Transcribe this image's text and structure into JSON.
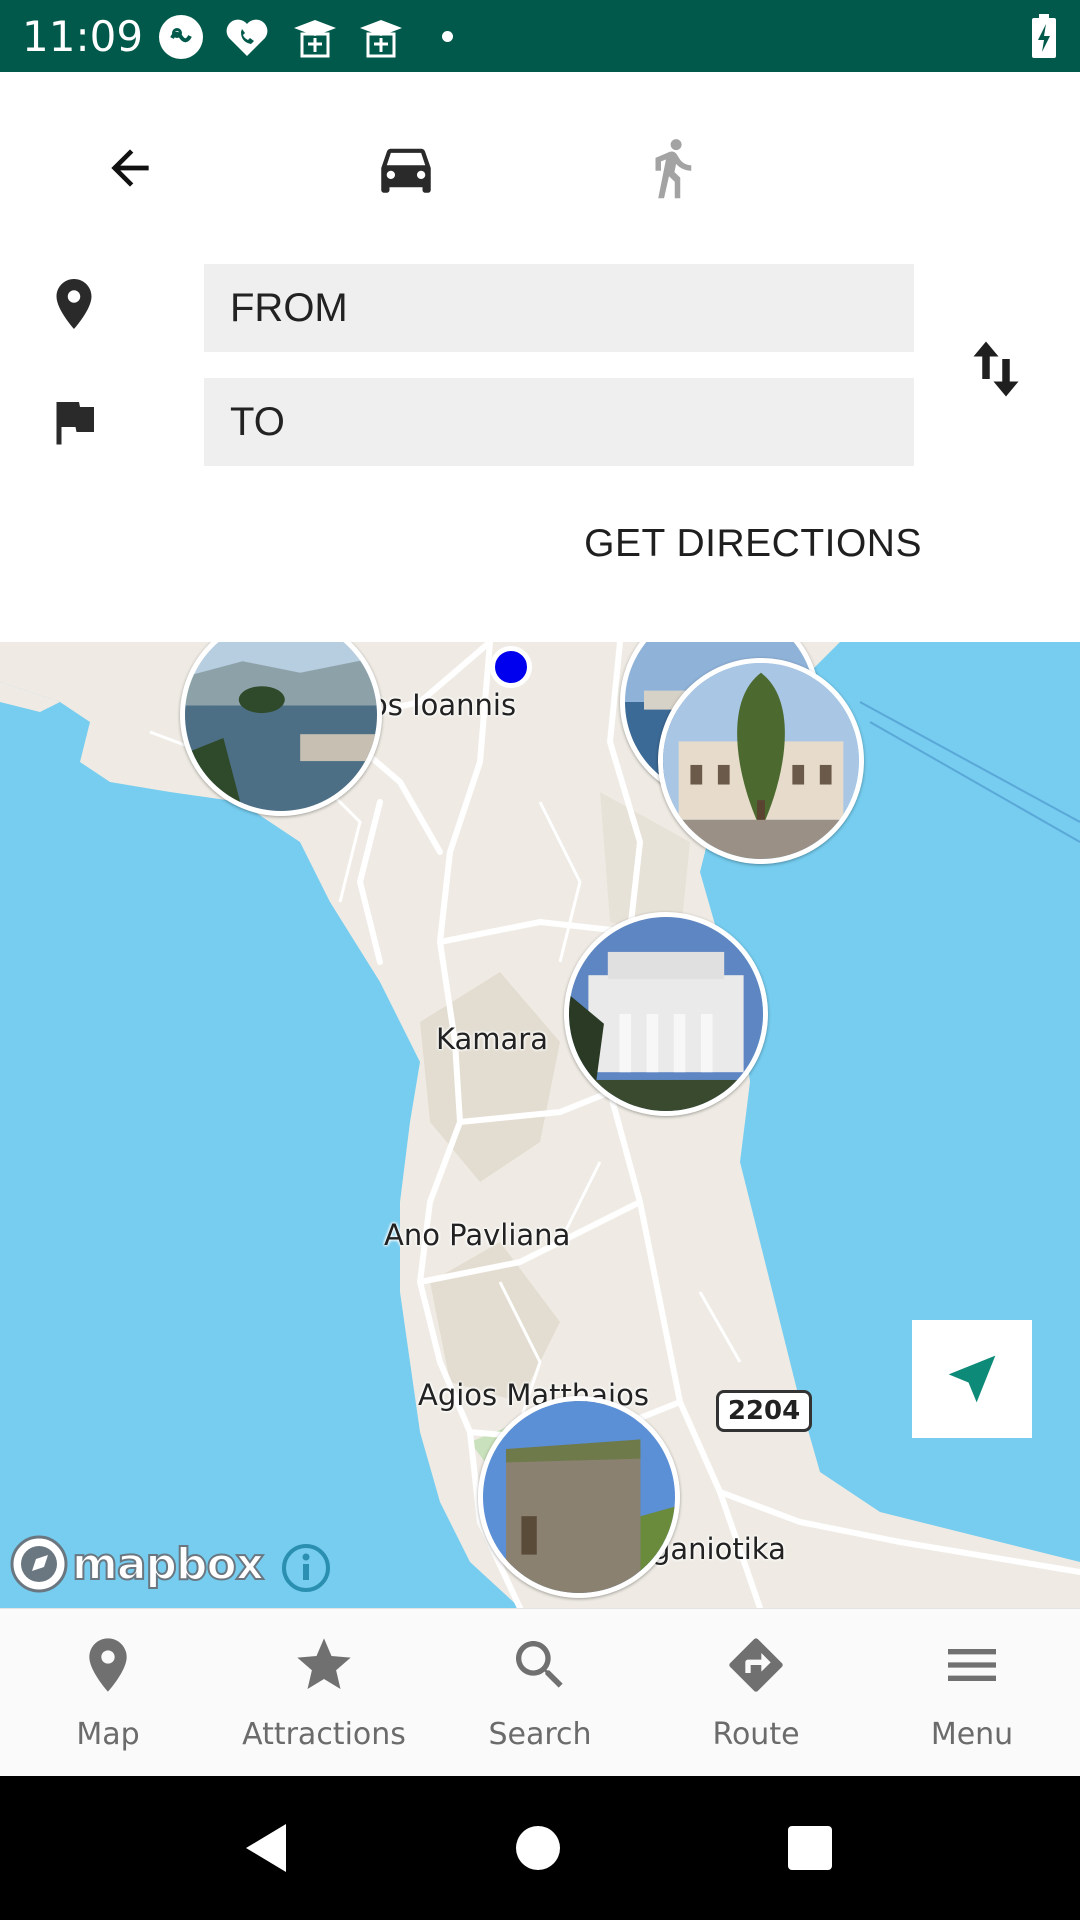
{
  "status_bar": {
    "time": "11:09",
    "background_color": "#00594a",
    "icons": [
      "app-icon",
      "heart-phone-icon",
      "graduation-cap-icon",
      "graduation-cap-icon",
      "dot-icon",
      "battery-charging-icon"
    ]
  },
  "directions": {
    "back_icon": "arrow-back-icon",
    "modes": [
      {
        "name": "car-icon",
        "selected": true
      },
      {
        "name": "walk-icon",
        "selected": false
      }
    ],
    "from_placeholder": "FROM",
    "to_placeholder": "TO",
    "swap_icon": "swap-vertical-icon",
    "get_directions_label": "GET DIRECTIONS"
  },
  "map": {
    "labels": {
      "ioannis": "os Ioannis",
      "kamara": "Kamara",
      "ano_pavliana": "Ano Pavliana",
      "agios_matthaios": "Agios Matthaios",
      "lefkimmi": "ganiotika"
    },
    "road_badge": "2204",
    "attribution": "mapbox",
    "accent_color": "#0e8a78",
    "water_color": "#76cdef",
    "land_color": "#efebe4"
  },
  "bottom_nav": {
    "items": [
      {
        "label": "Map",
        "icon": "map-pin-icon"
      },
      {
        "label": "Attractions",
        "icon": "star-icon"
      },
      {
        "label": "Search",
        "icon": "search-icon"
      },
      {
        "label": "Route",
        "icon": "directions-icon"
      },
      {
        "label": "Menu",
        "icon": "menu-icon"
      }
    ]
  }
}
